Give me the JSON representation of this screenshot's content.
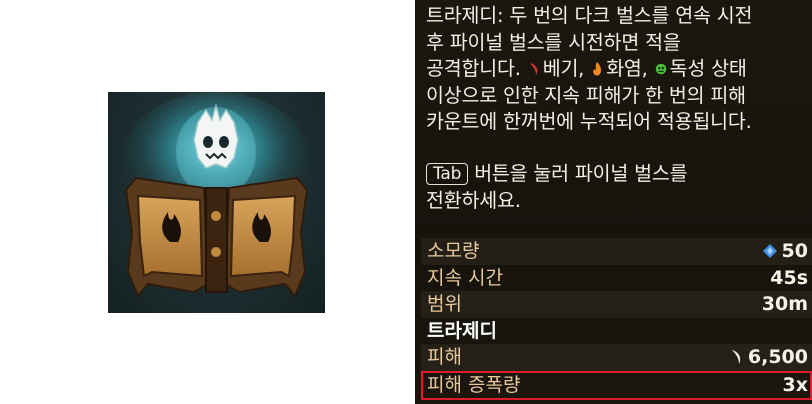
{
  "tooltip": {
    "description_lines": [
      "트라제디: 두 번의 다크 벌스를 연속 시전",
      "후 파이널 벌스를 시전하면 적을"
    ],
    "desc_line3_prefix": "공격합니다. ",
    "status_bleed": "베기,",
    "status_burn": "화염,",
    "status_poison": "독성 상태",
    "description_lines_after": [
      "이상으로 인한 지속 피해가 한 번의 피해",
      "카운트에 한꺼번에 누적되어 적용됩니다."
    ],
    "tab_key": "Tab",
    "hint_line1_suffix": "버튼을 눌러 파이널 벌스를",
    "hint_line2": "전환하세요.",
    "stats": [
      {
        "label": "소모량",
        "value": "50",
        "icon": "soul-crystal-icon"
      },
      {
        "label": "지속 시간",
        "value": "45s"
      },
      {
        "label": "범위",
        "value": "30m"
      }
    ],
    "section_title": "트라제디",
    "section_stats": [
      {
        "label": "피해",
        "value": "6,500",
        "icon": "slash-damage-icon"
      },
      {
        "label": "피해 증폭량",
        "value": "3x",
        "highlighted": true
      }
    ]
  },
  "colors": {
    "panel_bg": "#18140e",
    "label_color": "#e8c89a",
    "highlight_border": "#e01c2c",
    "bleed_icon": "#d2342a",
    "burn_icon": "#f08a1a",
    "poison_icon": "#4bbf3c",
    "crystal_icon": "#3f8fe0"
  }
}
